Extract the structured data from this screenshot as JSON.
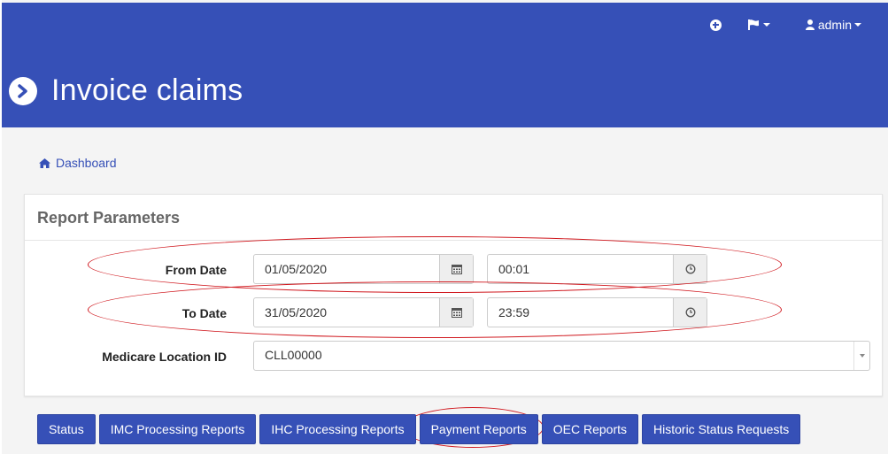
{
  "header": {
    "title": "Invoice claims",
    "nav": {
      "add_icon": "plus-circle-icon",
      "flag_icon": "flag-icon",
      "user_icon": "user-icon",
      "user_label": "admin"
    }
  },
  "breadcrumb": {
    "icon": "home-icon",
    "label": "Dashboard"
  },
  "panel": {
    "title": "Report Parameters",
    "from_date": {
      "label": "From Date",
      "date": "01/05/2020",
      "time": "00:01"
    },
    "to_date": {
      "label": "To Date",
      "date": "31/05/2020",
      "time": "23:59"
    },
    "location": {
      "label": "Medicare Location ID",
      "value": "CLL00000"
    }
  },
  "tabs": [
    {
      "label": "Status"
    },
    {
      "label": "IMC Processing Reports"
    },
    {
      "label": "IHC Processing Reports"
    },
    {
      "label": "Payment Reports"
    },
    {
      "label": "OEC Reports"
    },
    {
      "label": "Historic Status Requests"
    }
  ],
  "colors": {
    "brand": "#3650b7",
    "annotation": "#d0191f"
  }
}
